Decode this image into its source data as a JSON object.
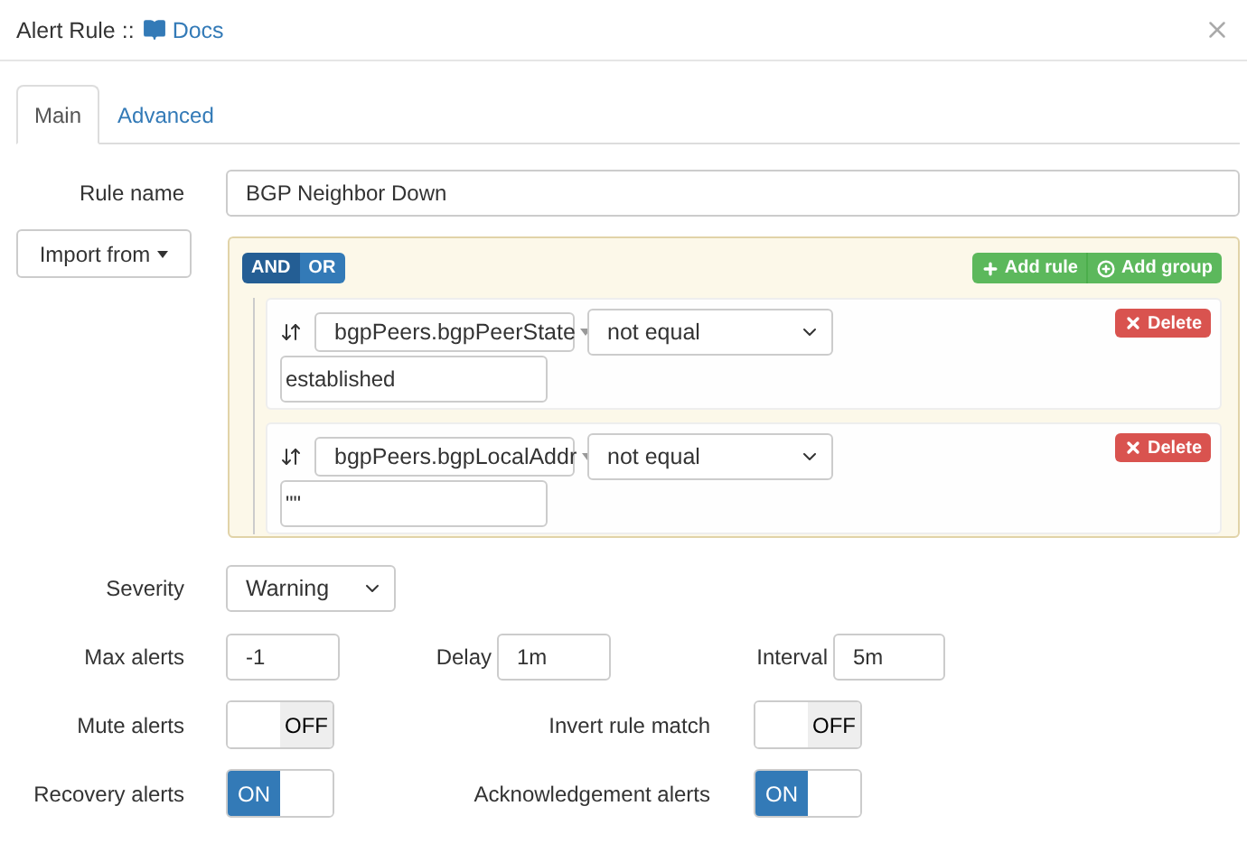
{
  "dialog": {
    "title": "Alert Rule ::",
    "docs_link": "Docs"
  },
  "tabs": [
    {
      "label": "Main",
      "selected": true
    },
    {
      "label": "Advanced",
      "selected": false
    }
  ],
  "rule_name": {
    "label": "Rule name",
    "value": "BGP Neighbor Down"
  },
  "import_button": {
    "label": "Import from"
  },
  "query_builder": {
    "conditions": [
      {
        "label": "AND",
        "selected": true
      },
      {
        "label": "OR",
        "selected": false
      }
    ],
    "add_rule": "Add rule",
    "add_group": "Add group",
    "rules": [
      {
        "field": "bgpPeers.bgpPeerState",
        "operator": "not equal",
        "value": "established",
        "delete": "Delete"
      },
      {
        "field": "bgpPeers.bgpLocalAddr",
        "operator": "not equal",
        "value": "\"\"",
        "delete": "Delete"
      }
    ]
  },
  "severity": {
    "label": "Severity",
    "value": "Warning"
  },
  "timing": [
    {
      "label": "Max alerts",
      "value": "-1"
    },
    {
      "label": "Delay",
      "value": "1m"
    },
    {
      "label": "Interval",
      "value": "5m"
    }
  ],
  "toggles": [
    {
      "label": "Mute alerts",
      "on": false,
      "text": "OFF"
    },
    {
      "label": "Invert rule match",
      "on": false,
      "text": "OFF"
    },
    {
      "label": "Recovery alerts",
      "on": true,
      "text": "ON"
    },
    {
      "label": "Acknowledgement alerts",
      "on": true,
      "text": "ON"
    }
  ]
}
